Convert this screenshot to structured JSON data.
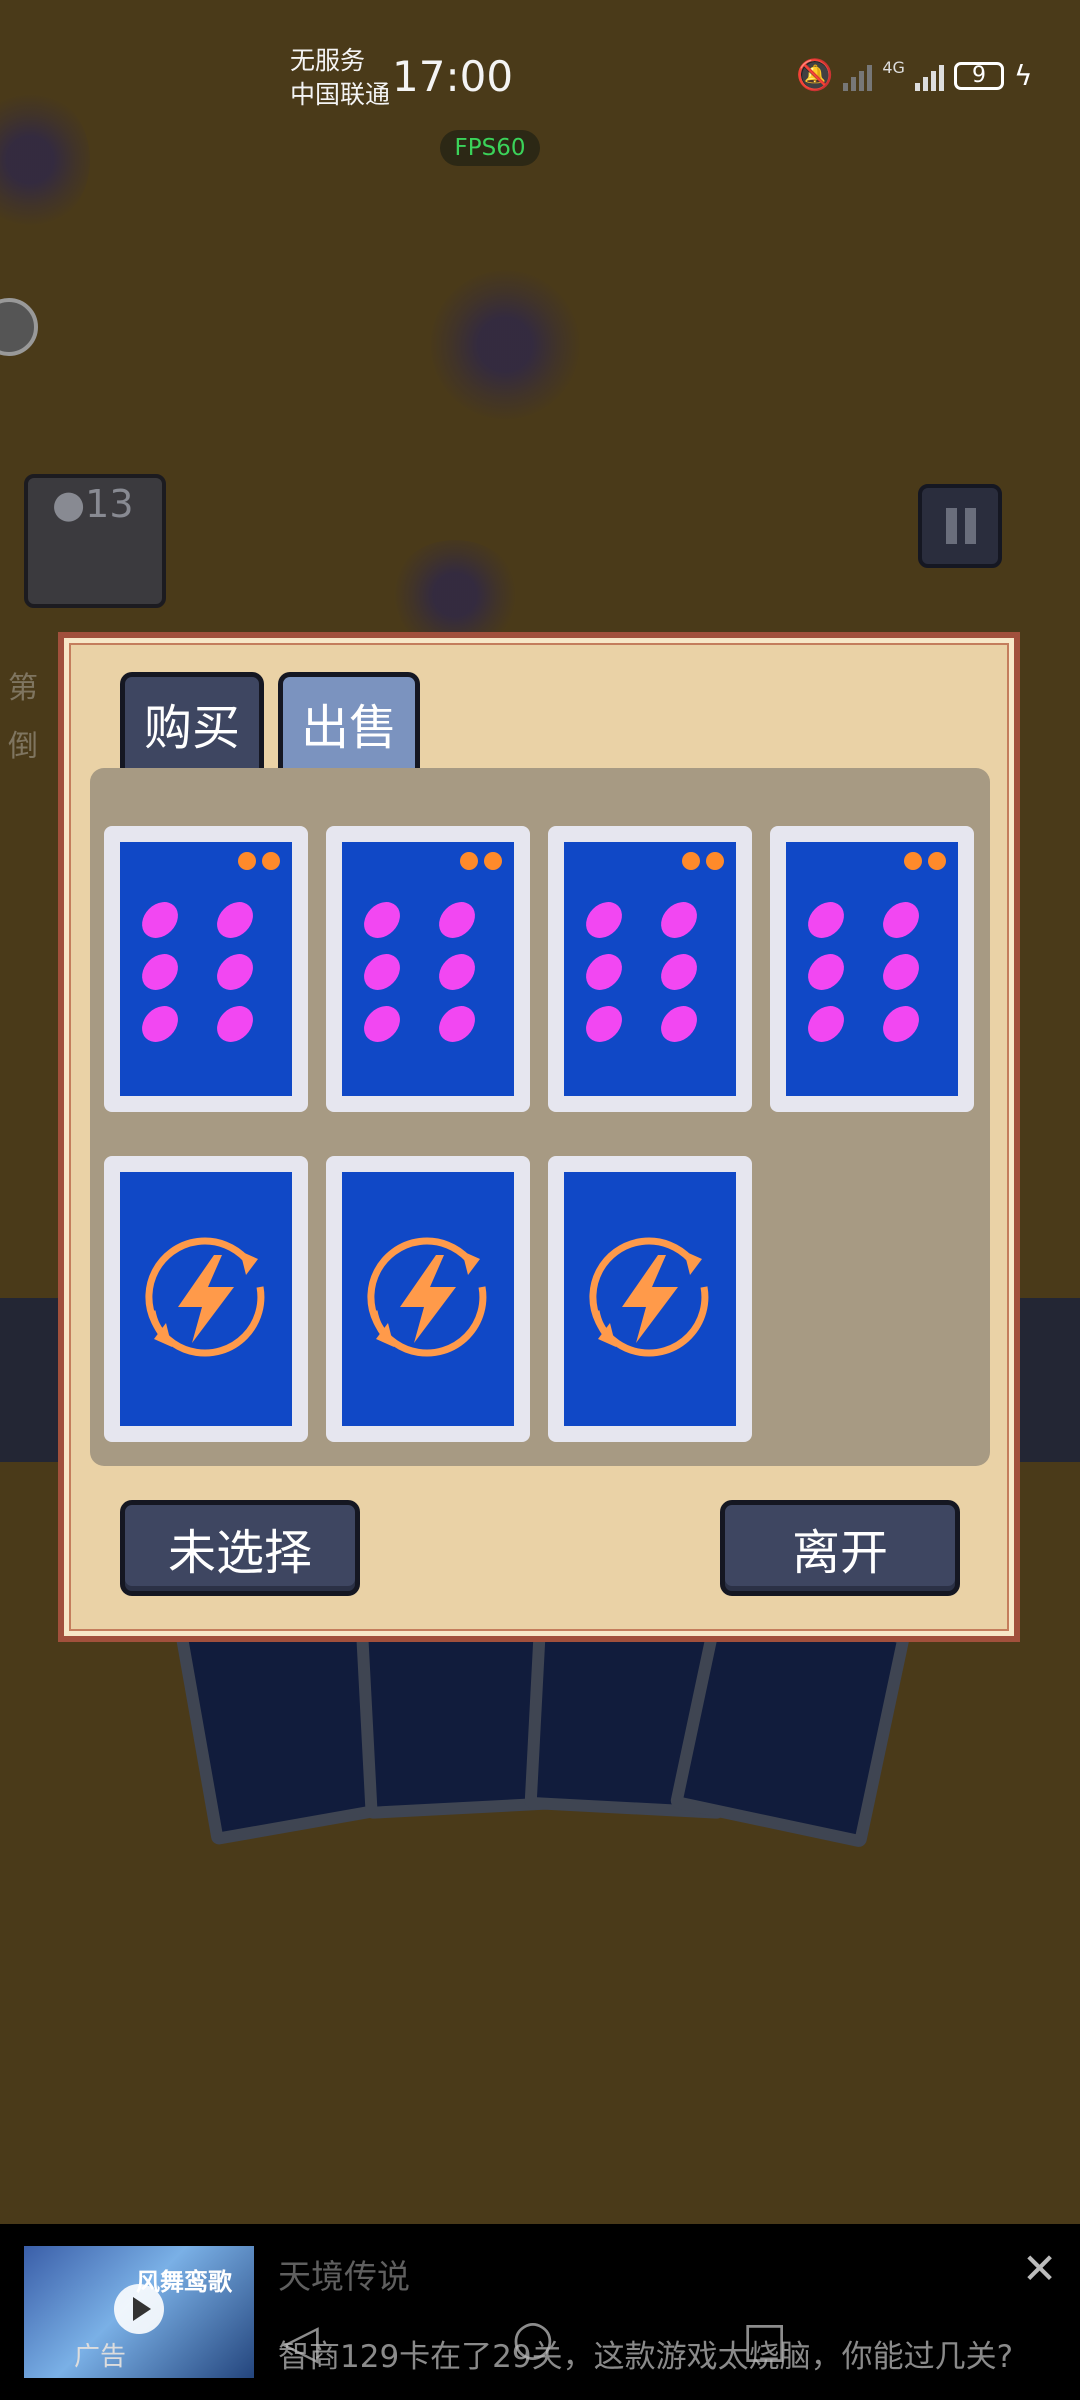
{
  "status_bar": {
    "carrier_line1": "无服务",
    "carrier_line2": "中国联通",
    "time": "17:00",
    "network": "4G",
    "battery": "9",
    "icons": [
      "mute-bell-icon",
      "no-signal-icon",
      "signal-icon",
      "battery-icon",
      "charging-icon"
    ]
  },
  "fps": "FPS60",
  "hud": {
    "coin_count": "13",
    "side_text_1": "第",
    "side_text_2": "倒"
  },
  "shop": {
    "tabs": [
      {
        "label": "购买",
        "active": false
      },
      {
        "label": "出售",
        "active": true
      }
    ],
    "cards": [
      {
        "type": "pips",
        "pip_count": 6,
        "cost_dots": 2
      },
      {
        "type": "pips",
        "pip_count": 6,
        "cost_dots": 2
      },
      {
        "type": "pips",
        "pip_count": 6,
        "cost_dots": 2
      },
      {
        "type": "pips",
        "pip_count": 6,
        "cost_dots": 2
      },
      {
        "type": "energy",
        "icon": "lightning-icon"
      },
      {
        "type": "energy",
        "icon": "lightning-icon"
      },
      {
        "type": "energy",
        "icon": "lightning-icon"
      }
    ],
    "select_button": "未选择",
    "leave_button": "离开"
  },
  "ad": {
    "thumb_title": "风舞鸾歌",
    "label": "广告",
    "title": "天境传说",
    "description": "智商129卡在了29关，这款游戏太烧脑，你能过几关?"
  },
  "colors": {
    "card_face": "#1048c6",
    "pip": "#f247f2",
    "accent": "#ff8a2a",
    "modal": "#ead2a6",
    "button": "#3e4661"
  }
}
